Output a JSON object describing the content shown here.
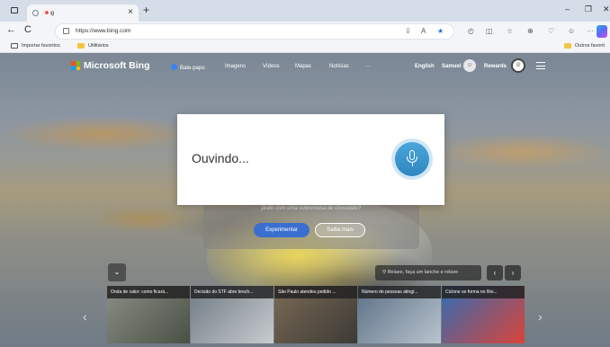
{
  "browser": {
    "tab": {
      "title": "Bing",
      "close": "×"
    },
    "new_tab": "+",
    "window_buttons": {
      "minimize": "–",
      "maximize": "❐",
      "close": "✕"
    },
    "nav": {
      "back": "←",
      "refresh": "C"
    },
    "address": {
      "url": "https://www.bing.com"
    },
    "toolbar_more": "···",
    "bookmarks": [
      {
        "label": "Importar favoritos",
        "icon": "import-icon"
      },
      {
        "label": "Utilitários",
        "icon": "folder-icon"
      }
    ],
    "other_favorites": "Outros favorit"
  },
  "bing": {
    "logo": "Microsoft Bing",
    "nav": [
      {
        "label": "Bate-papo"
      },
      {
        "label": "Imagens"
      },
      {
        "label": "Vídeos"
      },
      {
        "label": "Mapas"
      },
      {
        "label": "Notícias"
      },
      {
        "label": "···"
      }
    ],
    "language": "English",
    "user": "Samuel",
    "rewards": "Rewards"
  },
  "voice_dialog": {
    "status": "Ouvindo..."
  },
  "quiz": {
    "text": "prato com uma sobremesa de chocolate?",
    "try_button": "Experimentar",
    "more_button": "Saiba mais"
  },
  "feed": {
    "search_placeholder": "Relaxe, faça um lanche e relaxe",
    "collapse": "⌄",
    "prev": "‹",
    "next": "›",
    "cards": [
      {
        "title": "Onda de calor: como ficará...",
        "colors": [
          "#8a8f86",
          "#4a5043"
        ]
      },
      {
        "title": "Decisão do STF abre brech...",
        "colors": [
          "#6f7a83",
          "#c8ccd0"
        ]
      },
      {
        "title": "São Paulo atendeu pedido ...",
        "colors": [
          "#7b6a55",
          "#3c3a36"
        ]
      },
      {
        "title": "Número de pessoas atingi...",
        "colors": [
          "#5b6f86",
          "#b9c4ce"
        ]
      },
      {
        "title": "Ciclone se forma no Rio...",
        "colors": [
          "#2f6db5",
          "#d9443a"
        ]
      }
    ]
  },
  "colors": {
    "tabstrip": "#d4dde8",
    "accent": "#3b6fcf",
    "mic": "#3a93cc"
  }
}
